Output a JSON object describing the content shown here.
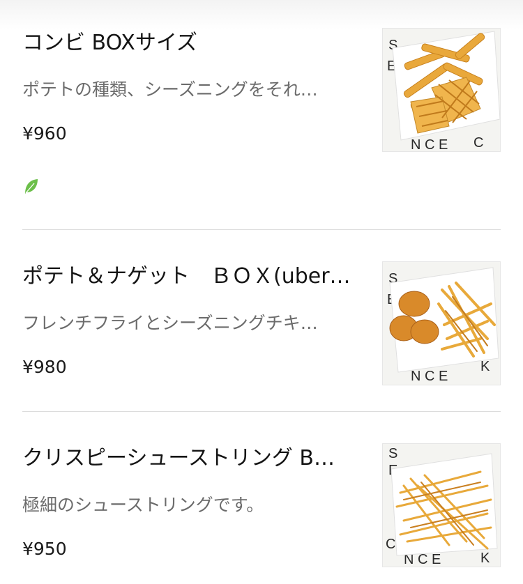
{
  "items": [
    {
      "title": "コンビ BOXサイズ",
      "description": "ポテトの種類、シーズニングをそれ…",
      "price": "¥960",
      "badge_icon": "leaf-icon"
    },
    {
      "title": "ポテト＆ナゲット　ＢＯＸ(uber…",
      "description": "フレンチフライとシーズニングチキ…",
      "price": "¥980"
    },
    {
      "title": "クリスピーシューストリング B…",
      "description": "極細のシューストリングです。",
      "price": "¥950"
    }
  ],
  "colors": {
    "leaf": "#6cbf4a",
    "divider": "#dcdcdc",
    "fries": "#e8a93a"
  }
}
